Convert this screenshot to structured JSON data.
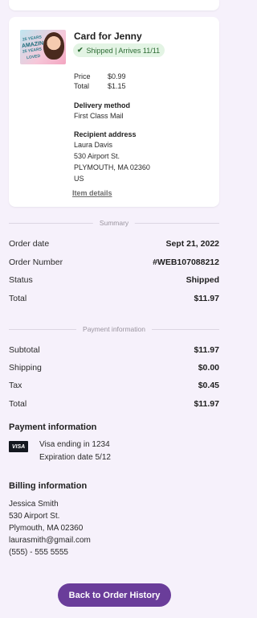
{
  "item": {
    "title": "Card for Jenny",
    "status_badge": "Shipped | Arrives 11/11",
    "thumb_text": [
      "25 YEARS",
      "AMAZING",
      "25 YEARS",
      "LOVED"
    ],
    "price_label": "Price",
    "price_value": "$0.99",
    "total_label": "Total",
    "total_value": "$1.15",
    "delivery_method_label": "Delivery method",
    "delivery_method_value": "First Class Mail",
    "recipient_label": "Recipient address",
    "recipient_lines": [
      "Laura Davis",
      "530 Airport St.",
      "PLYMOUTH, MA 02360",
      "US"
    ],
    "item_details_link": "Item details"
  },
  "summary": {
    "heading": "Summary",
    "rows": [
      {
        "label": "Order date",
        "value": "Sept 21, 2022"
      },
      {
        "label": "Order Number",
        "value": "#WEB107088212"
      },
      {
        "label": "Status",
        "value": "Shipped"
      },
      {
        "label": "Total",
        "value": "$11.97"
      }
    ]
  },
  "payment": {
    "heading": "Payment information",
    "rows": [
      {
        "label": "Subtotal",
        "value": "$11.97"
      },
      {
        "label": "Shipping",
        "value": "$0.00"
      },
      {
        "label": "Tax",
        "value": "$0.45"
      },
      {
        "label": "Total",
        "value": "$11.97"
      }
    ],
    "section_title": "Payment information",
    "card_brand": "VISA",
    "card_line": "Visa ending in 1234",
    "expiry_line": "Expiration date 5/12"
  },
  "billing": {
    "title": "Billing information",
    "lines": [
      "Jessica Smith",
      "530 Airport St.",
      "Plymouth, MA 02360",
      "laurasmith@gmail.com",
      "(555) - 555 5555"
    ]
  },
  "actions": {
    "back_label": "Back to Order History"
  },
  "colors": {
    "accent": "#6a3d9a",
    "background": "#f6f1fb",
    "shipped_badge_bg": "#e3f4e4",
    "shipped_badge_text": "#2b6a32"
  }
}
